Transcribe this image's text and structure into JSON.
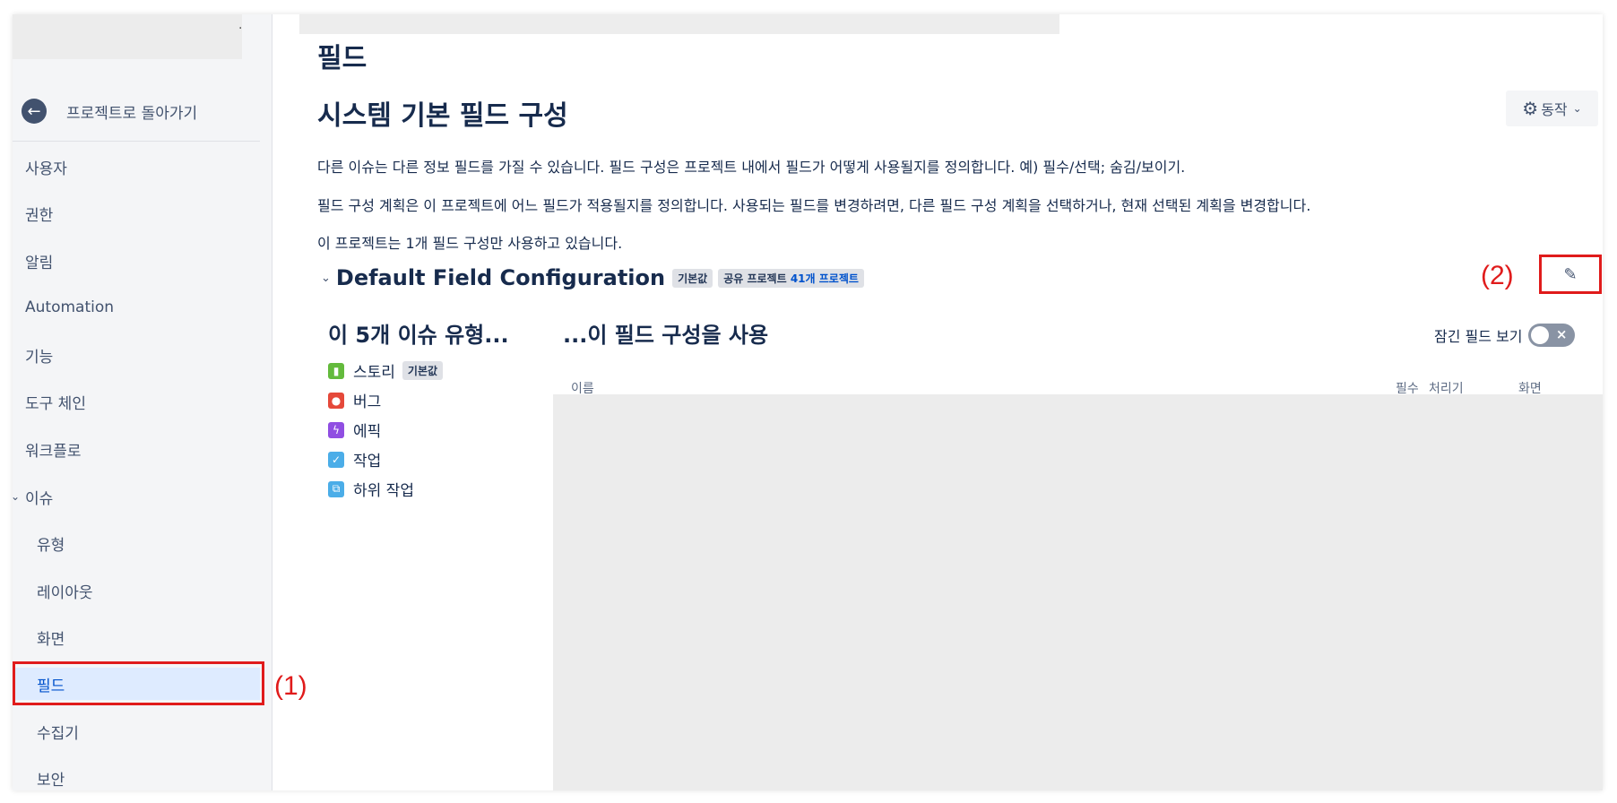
{
  "sidebar": {
    "back_label": "프로젝트로 돌아가기",
    "items": [
      {
        "label": "사용자"
      },
      {
        "label": "권한"
      },
      {
        "label": "알림"
      },
      {
        "label": "Automation"
      },
      {
        "label": "기능"
      },
      {
        "label": "도구 체인"
      },
      {
        "label": "워크플로"
      },
      {
        "label": "이슈"
      },
      {
        "label": "유형"
      },
      {
        "label": "레이아웃"
      },
      {
        "label": "화면"
      },
      {
        "label": "필드"
      },
      {
        "label": "수집기"
      },
      {
        "label": "보안"
      }
    ]
  },
  "annotations": {
    "label_1": "(1)",
    "label_2": "(2)"
  },
  "main": {
    "page_title": "필드",
    "config_title": "시스템 기본 필드 구성",
    "actions_label": "동작",
    "desc1": "다른 이슈는 다른 정보 필드를 가질 수 있습니다. 필드 구성은 프로젝트 내에서 필드가 어떻게 사용될지를 정의합니다. 예) 필수/선택; 숨김/보이기.",
    "desc2": "필드 구성 계획은 이 프로젝트에 어느 필드가 적용될지를 정의합니다. 사용되는 필드를 변경하려면, 다른 필드 구성 계획을 선택하거나, 현재 선택된 계획을 변경합니다.",
    "desc3": "이 프로젝트는 1개 필드 구성만 사용하고 있습니다.",
    "scheme": {
      "name": "Default Field Configuration",
      "default_badge": "기본값",
      "shared_prefix": "공유 프로젝트",
      "shared_link": "41개 프로젝트"
    },
    "left_col_title": "이 5개 이슈 유형...",
    "issue_types": [
      {
        "name": "스토리",
        "badge": "기본값",
        "icon": "story-icon",
        "color": "#63ba3c"
      },
      {
        "name": "버그",
        "badge": "",
        "icon": "bug-icon",
        "color": "#e5493a"
      },
      {
        "name": "에픽",
        "badge": "",
        "icon": "epic-icon",
        "color": "#904ee2"
      },
      {
        "name": "작업",
        "badge": "",
        "icon": "task-icon",
        "color": "#4bade8"
      },
      {
        "name": "하위 작업",
        "badge": "",
        "icon": "subtask-icon",
        "color": "#4bade8"
      }
    ],
    "right_col_title": "...이 필드 구성을 사용",
    "locked_fields_label": "잠긴 필드 보기",
    "table_headers": {
      "name": "이름",
      "required": "필수",
      "renderer": "처리기",
      "screen": "화면"
    }
  },
  "colors": {
    "annotation": "#e01b1b",
    "active_nav": "#deebff",
    "link": "#0052cc"
  }
}
